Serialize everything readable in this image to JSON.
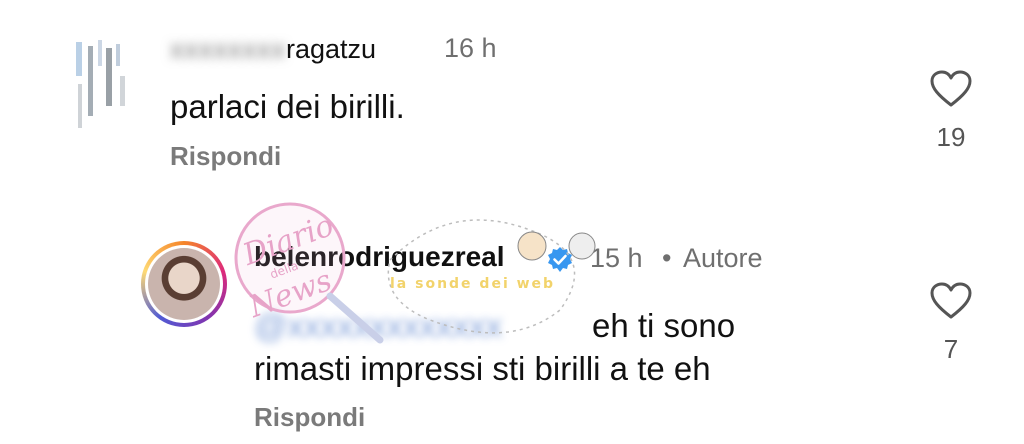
{
  "comments": [
    {
      "username_visible": "ragatzu",
      "time": "16 h",
      "text": "parlaci dei birilli.",
      "reply_label": "Rispondi",
      "likes": "19"
    },
    {
      "username": "belenrodriguezreal",
      "verified": true,
      "time": "15 h",
      "separator": "•",
      "author_badge": "Autore",
      "mention_visible": "",
      "text_line1": "eh ti sono",
      "text_line2": "rimasti impressi sti birilli a te eh",
      "reply_label": "Rispondi",
      "likes": "7"
    }
  ],
  "icons": {
    "like": "heart-outline-icon",
    "verified": "verified-badge-icon"
  },
  "colors": {
    "verified_blue": "#3897f0",
    "mention_blue": "#3f6fc6",
    "muted_text": "#6f6f6f"
  },
  "watermark": {
    "line1": "Diario",
    "line2": "della",
    "line3": "News",
    "line4": "la sonde dei web"
  }
}
